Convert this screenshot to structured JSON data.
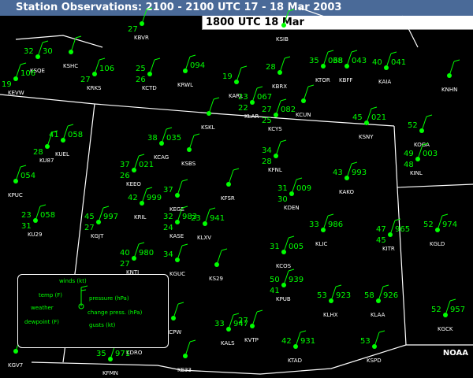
{
  "header": {
    "title": "Station Observations: 2100 - 2100 UTC  17 - 18 Mar 2003"
  },
  "time_box": {
    "label": "1800 UTC 18  Mar"
  },
  "credit": "NOAA",
  "legend": {
    "winds": "winds (kt)",
    "temp": "temp (F)",
    "pressure": "pressure (hPa)",
    "weather": "weather",
    "change": "change press. (hPa)",
    "dewpoint": "dewpoint (F)",
    "gusts": "gusts (kt)"
  },
  "stations": [
    {
      "id": "KBVR",
      "t": "",
      "d": "27",
      "p": ""
    },
    {
      "id": "KSQE",
      "t": "32",
      "d": "",
      "p": "30"
    },
    {
      "id": "KSHC",
      "t": "",
      "d": "",
      "p": ""
    },
    {
      "id": "KEVW",
      "t": "",
      "d": "19",
      "p": "106"
    },
    {
      "id": "KRKS",
      "t": "",
      "d": "27",
      "p": "106"
    },
    {
      "id": "KCTD",
      "t": "25",
      "d": "26",
      "p": ""
    },
    {
      "id": "KRWL",
      "t": "",
      "d": "",
      "p": "094"
    },
    {
      "id": "KSIB",
      "t": "",
      "d": "",
      "p": ""
    },
    {
      "id": "KBRX",
      "t": "28",
      "d": "",
      "p": ""
    },
    {
      "id": "KTOR",
      "t": "35",
      "d": "",
      "p": "068"
    },
    {
      "id": "KBFF",
      "t": "38",
      "d": "",
      "p": "043"
    },
    {
      "id": "KAIA",
      "t": "40",
      "d": "",
      "p": "041"
    },
    {
      "id": "KNHN",
      "t": "",
      "d": "",
      "p": ""
    },
    {
      "id": "KARL",
      "t": "19",
      "d": "",
      "p": ""
    },
    {
      "id": "KLAR",
      "t": "23",
      "d": "22",
      "p": "067"
    },
    {
      "id": "KCUN",
      "t": "",
      "d": "",
      "p": ""
    },
    {
      "id": "KCYS",
      "t": "27",
      "d": "25",
      "p": "082"
    },
    {
      "id": "KSKL",
      "t": "",
      "d": "",
      "p": ""
    },
    {
      "id": "KSNY",
      "t": "45",
      "d": "",
      "p": "021"
    },
    {
      "id": "KOGA",
      "t": "52",
      "d": "",
      "p": ""
    },
    {
      "id": "KUEL",
      "t": "41",
      "d": "",
      "p": "058"
    },
    {
      "id": "KU87",
      "t": "",
      "d": "28",
      "p": ""
    },
    {
      "id": "KCAG",
      "t": "38",
      "d": "",
      "p": "035"
    },
    {
      "id": "KSBS",
      "t": "",
      "d": "",
      "p": ""
    },
    {
      "id": "KFNL",
      "t": "34",
      "d": "28",
      "p": ""
    },
    {
      "id": "KEEO",
      "t": "37",
      "d": "26",
      "p": "021"
    },
    {
      "id": "KPUC",
      "t": "",
      "d": "",
      "p": "054"
    },
    {
      "id": "KFSR",
      "t": "",
      "d": "",
      "p": ""
    },
    {
      "id": "KDEN",
      "t": "31",
      "d": "30",
      "p": "009"
    },
    {
      "id": "KAKO",
      "t": "43",
      "d": "",
      "p": "993"
    },
    {
      "id": "KINL",
      "t": "49",
      "d": "48",
      "p": "003"
    },
    {
      "id": "KRIL",
      "t": "42",
      "d": "",
      "p": "999"
    },
    {
      "id": "KEGE",
      "t": "37",
      "d": "",
      "p": ""
    },
    {
      "id": "KU29",
      "t": "23",
      "d": "31",
      "p": "058"
    },
    {
      "id": "KGJT",
      "t": "45",
      "d": "27",
      "p": "997"
    },
    {
      "id": "KASE",
      "t": "32",
      "d": "24",
      "p": "983"
    },
    {
      "id": "KLXV",
      "t": "23",
      "d": "",
      "p": "941"
    },
    {
      "id": "KLIC",
      "t": "33",
      "d": "",
      "p": "986"
    },
    {
      "id": "KITR",
      "t": "47",
      "d": "45",
      "p": "965"
    },
    {
      "id": "KGLD",
      "t": "52",
      "d": "",
      "p": "974"
    },
    {
      "id": "KCOS",
      "t": "31",
      "d": "",
      "p": "005"
    },
    {
      "id": "KNTJ",
      "t": "40",
      "d": "27",
      "p": "980"
    },
    {
      "id": "KGUC",
      "t": "34",
      "d": "",
      "p": ""
    },
    {
      "id": "KS29",
      "t": "",
      "d": "",
      "p": ""
    },
    {
      "id": "KPUB",
      "t": "50",
      "d": "41",
      "p": "939"
    },
    {
      "id": "KLHX",
      "t": "53",
      "d": "",
      "p": "923"
    },
    {
      "id": "KLAA",
      "t": "58",
      "d": "",
      "p": "926"
    },
    {
      "id": "KGCK",
      "t": "52",
      "d": "",
      "p": "957"
    },
    {
      "id": "KCPW",
      "t": "",
      "d": "",
      "p": ""
    },
    {
      "id": "KALS",
      "t": "33",
      "d": "",
      "p": "947"
    },
    {
      "id": "KVTP",
      "t": "27",
      "d": "",
      "p": ""
    },
    {
      "id": "KTAD",
      "t": "42",
      "d": "",
      "p": "931"
    },
    {
      "id": "KSPD",
      "t": "53",
      "d": "",
      "p": ""
    },
    {
      "id": "KDRO",
      "t": "",
      "d": "",
      "p": ""
    },
    {
      "id": "KFMN",
      "t": "35",
      "d": "",
      "p": "971"
    },
    {
      "id": "KE33",
      "t": "",
      "d": "",
      "p": ""
    },
    {
      "id": "KGV7",
      "t": "",
      "d": "",
      "p": ""
    }
  ]
}
